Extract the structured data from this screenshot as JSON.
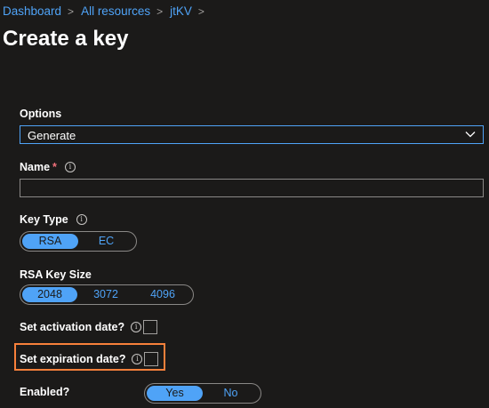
{
  "breadcrumb": [
    "Dashboard",
    "All resources",
    "jtKV"
  ],
  "page_title": "Create a key",
  "options": {
    "label": "Options",
    "value": "Generate",
    "icon": "chevron-down-icon"
  },
  "name": {
    "label": "Name",
    "required_mark": "*",
    "value": "",
    "placeholder": ""
  },
  "key_type": {
    "label": "Key Type",
    "options": [
      "RSA",
      "EC"
    ],
    "selected": "RSA"
  },
  "rsa_key_size": {
    "label": "RSA Key Size",
    "options": [
      "2048",
      "3072",
      "4096"
    ],
    "selected": "2048"
  },
  "activation": {
    "label": "Set activation date?",
    "checked": false
  },
  "expiration": {
    "label": "Set expiration date?",
    "checked": false
  },
  "enabled": {
    "label": "Enabled?",
    "options": [
      "Yes",
      "No"
    ],
    "selected": "Yes"
  },
  "info_glyph": "i",
  "colors": {
    "accent": "#4fa3f7",
    "highlight": "#f7803b",
    "background": "#1b1a19",
    "required": "#f1707b"
  }
}
